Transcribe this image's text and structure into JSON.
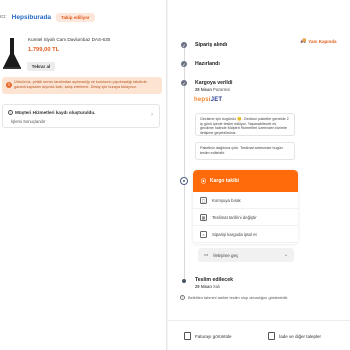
{
  "seller": {
    "prefix": "ıcı:",
    "name": "Hepsiburada",
    "follow": "Takip ediliyor"
  },
  "product": {
    "title": "Kumtel Siyah Cam Davlumbaz DAS-630",
    "price": "1.799,00 TL",
    "reorder": "Tekrar al"
  },
  "warning": {
    "icon": "!",
    "text": "Ürününüz, yetkili servis tarafından açılmadığı ve kurulumu yapılmadığı takdirde garanti kapsamı dışında kalır, satış erteleme. Detay için buraya tıklayınız."
  },
  "service": {
    "title": "Müşteri Hizmetleri kaydı oluşturuldu.",
    "link": "İşlemi Sonuçlandır",
    "icon": "i"
  },
  "timeline": {
    "track_cargo": "Yanı Kapında",
    "steps": {
      "received": "Sipariş alındı",
      "prepared": "Hazırlandı",
      "shipped": "Kargoya verildi",
      "shipped_date": "28 Nisan",
      "shipped_day": "Pazartesi",
      "delivery": "Teslim edilecek",
      "delivery_date": "29 Nisan",
      "delivery_day": "Salı"
    },
    "courier": {
      "a": "hepsi",
      "b": "JET"
    },
    "messages": [
      "Gecikme için üzgünüz 😔. Gecikon paketler genelde 2 iş günü içinde teslim ediliyor. Yaşanabilecek ek gecikme halinde Müşteri Hizmetleri üzerinden bizimle iletişime geçebilirsiniz.",
      "Paketiniz dağıtıma çıktı. Teslimat adresinize bugün teslim edilebilir."
    ]
  },
  "actions": {
    "track": "Kargo takibi",
    "items": [
      "Komşuya bırak",
      "Teslimat tarihini değiştir",
      "Siparişi kargoda iptal et"
    ]
  },
  "contact": {
    "label": "İletişime geç"
  },
  "note": "Belirtilen tahmini tarihte teslim olup olmadığını gösterebilir.",
  "bottom": {
    "invoice": "Faturayı görüntüle",
    "returns": "İade ve diğer talepler"
  },
  "colors": {
    "accent": "#ff6b0b",
    "link": "#2468c4",
    "courier_orange": "#f08732",
    "courier_blue": "#2a3b8f"
  }
}
